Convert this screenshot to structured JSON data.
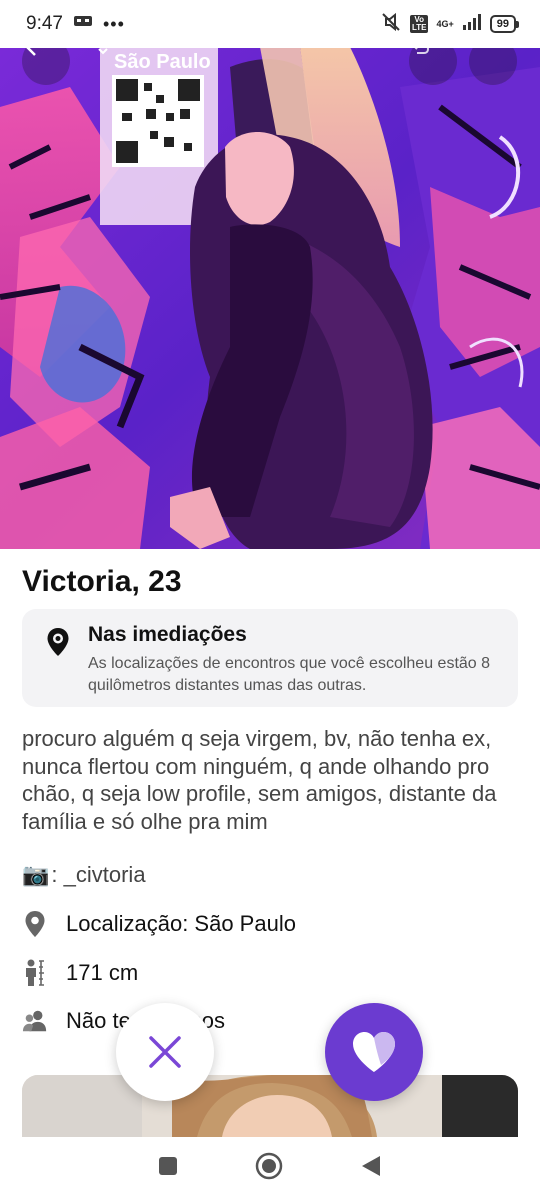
{
  "status_bar": {
    "time": "9:47",
    "network": "4G+",
    "volte": "Vo LTE",
    "battery": "99"
  },
  "header": {
    "city": "São Paulo"
  },
  "profile": {
    "name_age": "Victoria, 23",
    "nearby": {
      "title": "Nas imediações",
      "description": "As localizações de encontros que você escolheu estão 8 quilômetros distantes umas das outras."
    },
    "bio": "procuro alguém q seja virgem, bv, não tenha ex, nunca flertou com ninguém, q ande olhando pro chão, q seja low profile, sem amigos, distante da família e só olhe pra mim",
    "instagram_emoji": "📷",
    "instagram": ": _civtoria",
    "location": "Localização: São Paulo",
    "height": "171 cm",
    "kids": "Não tenho filhos"
  },
  "colors": {
    "accent": "#6b3bd0",
    "card_bg": "#f3f3f5"
  }
}
